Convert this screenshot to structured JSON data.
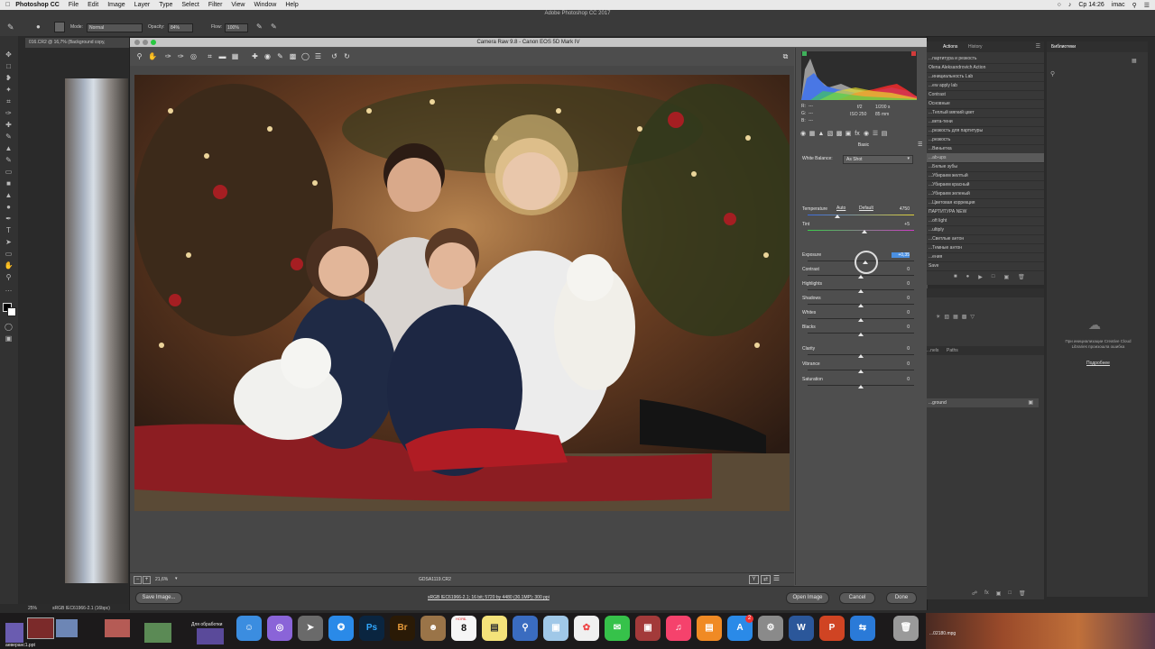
{
  "menubar": {
    "app_name": "Photoshop CC",
    "items": [
      "File",
      "Edit",
      "Image",
      "Layer",
      "Type",
      "Select",
      "Filter",
      "View",
      "Window",
      "Help"
    ],
    "clock": "Ср 14:26",
    "user": "imac"
  },
  "ps": {
    "window_title": "Adobe Photoshop CC 2017",
    "options": {
      "mode_label": "Mode:",
      "mode_value": "Normal",
      "opacity_label": "Opacity:",
      "opacity_value": "84%",
      "flow_label": "Flow:",
      "flow_value": "100%"
    },
    "doc_tab": "016.CR2 @ 16,7% (Background copy,",
    "status_zoom": "25%",
    "status_profile": "sRGB IEC61966-2.1 (16bpc)"
  },
  "camera_raw": {
    "title": "Camera Raw 9.8  -  Canon EOS 5D Mark IV",
    "zoom": "21,6%",
    "filename": "GDSA1119.CR2",
    "workflow_link": "sRGB IEC61966-2.1; 16 bit; 5720 by 4480 (30.1MP); 300 ppi",
    "buttons": {
      "save": "Save Image...",
      "open": "Open Image",
      "cancel": "Cancel",
      "done": "Done"
    },
    "readout": {
      "r": "R:",
      "g": "G:",
      "b": "B:",
      "dashes": "---",
      "fstop": "f/2",
      "shutter": "1/200 s",
      "iso": "ISO 250",
      "focal": "85 mm"
    },
    "panel_title": "Basic",
    "white_balance_label": "White Balance:",
    "white_balance_value": "As Shot",
    "auto": "Auto",
    "default": "Default",
    "controls": [
      {
        "label": "Temperature",
        "value": "4750",
        "pos": 0.28
      },
      {
        "label": "Tint",
        "value": "+5",
        "pos": 0.53
      },
      {
        "label": "Exposure",
        "value": "+0,35",
        "pos": 0.54
      },
      {
        "label": "Contrast",
        "value": "0",
        "pos": 0.5
      },
      {
        "label": "Highlights",
        "value": "0",
        "pos": 0.5
      },
      {
        "label": "Shadows",
        "value": "0",
        "pos": 0.5
      },
      {
        "label": "Whites",
        "value": "0",
        "pos": 0.5
      },
      {
        "label": "Blacks",
        "value": "0",
        "pos": 0.5
      },
      {
        "label": "Clarity",
        "value": "0",
        "pos": 0.5
      },
      {
        "label": "Vibrance",
        "value": "0",
        "pos": 0.5
      },
      {
        "label": "Saturation",
        "value": "0",
        "pos": 0.5
      }
    ]
  },
  "actions_panel": {
    "tabs": [
      "Actions",
      "History"
    ],
    "items": [
      "...партитура и резкость",
      "Olena Aleksandrovich Action",
      "...инициальность Lab",
      "...ew apply lab",
      "Contrast",
      "Основные",
      "...Теплый мягкий цвет",
      "...вета-тени",
      "...резкость для партитуры",
      "...резкость",
      "...Виньетка",
      "...ab-ups",
      "...Белые зубы",
      "...Убираем желтый",
      "...Убираем красный",
      "...Убираем зеленый",
      "...Цветовая коррекция",
      "ПАРТИТУРА NEW",
      "...oft light",
      "...ultiply",
      "...Светлые антон",
      "...Темные антон",
      "...ения",
      "Save"
    ]
  },
  "library_panel": {
    "title": "Библиотеки",
    "cc_message": "При инициализации Creative Cloud Libraries произошла ошибка",
    "link": "Подробнее"
  },
  "layers_panel": {
    "tabs": [
      "...nels",
      "Paths"
    ],
    "layer_name": "...ground"
  },
  "dock": {
    "calendar_day": "8",
    "calendar_month": "НОЯБ.",
    "ps": "Ps",
    "br": "Br",
    "word": "W",
    "badge": "2",
    "desktop_label": "Для обработки",
    "file1": "аеверанс1.ppt",
    "file2": "...02180.mpg"
  },
  "colors": {
    "accent": "#4a8fe0",
    "panel": "#4e4e4e",
    "menubar": "#e9e9e9"
  }
}
